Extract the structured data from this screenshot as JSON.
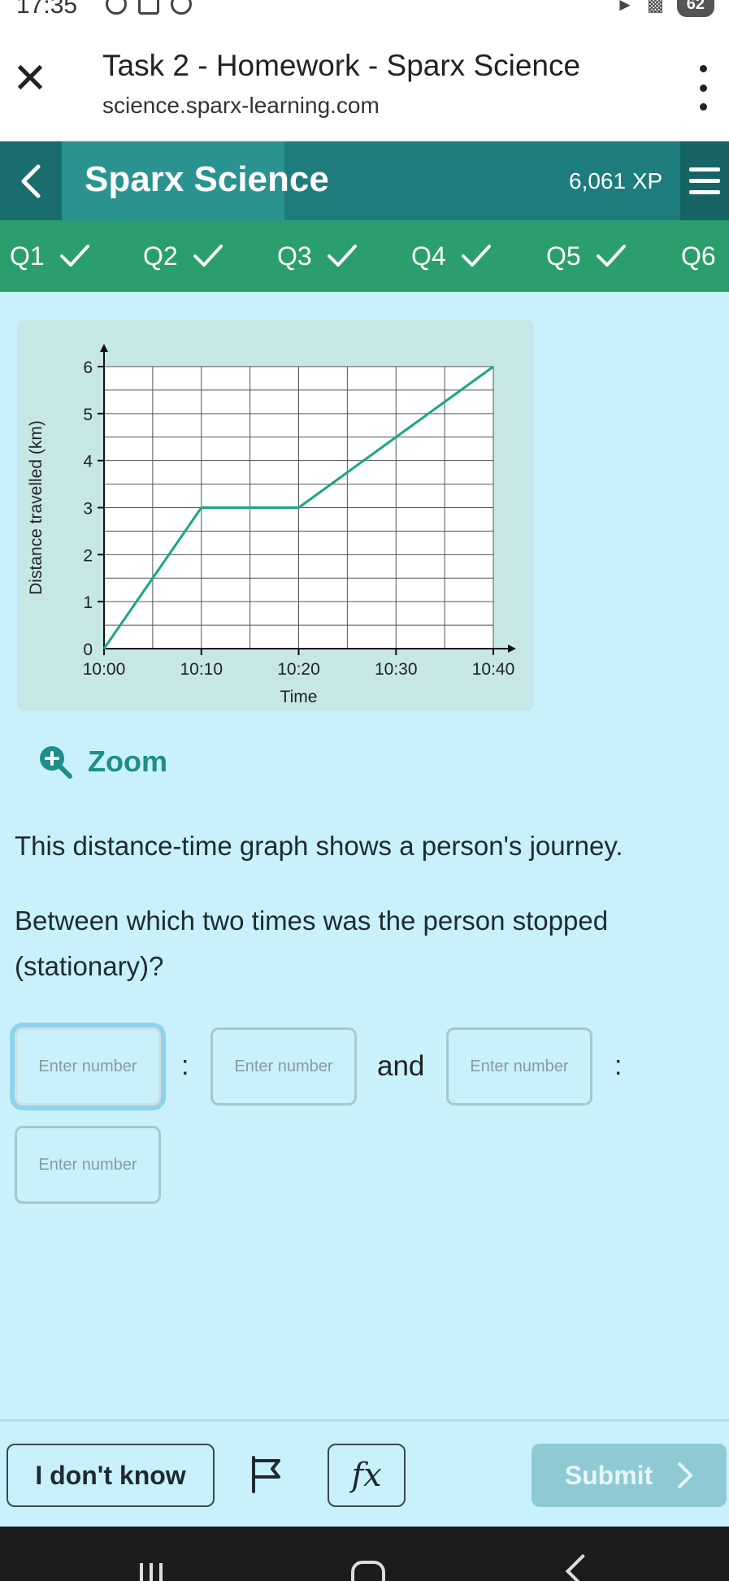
{
  "status_bar": {
    "time": "17:35",
    "battery": "62"
  },
  "browser": {
    "title": "Task 2 - Homework - Sparx Science",
    "url": "science.sparx-learning.com",
    "close_icon": "close-icon",
    "menu_icon": "kebab-menu-icon"
  },
  "app_header": {
    "brand": "Sparx Science",
    "xp": "6,061 XP"
  },
  "question_tabs": [
    {
      "label": "Q1",
      "completed": true
    },
    {
      "label": "Q2",
      "completed": true
    },
    {
      "label": "Q3",
      "completed": true
    },
    {
      "label": "Q4",
      "completed": true
    },
    {
      "label": "Q5",
      "completed": true
    },
    {
      "label": "Q6",
      "completed": false
    }
  ],
  "chart_data": {
    "type": "line",
    "title": "",
    "xlabel": "Time",
    "ylabel": "Distance travelled (km)",
    "x_tick_labels": [
      "10:00",
      "10:10",
      "10:20",
      "10:30",
      "10:40"
    ],
    "x_tick_values": [
      0,
      10,
      20,
      30,
      40
    ],
    "xlim": [
      0,
      40
    ],
    "ylim": [
      0,
      6
    ],
    "y_ticks": [
      0,
      1,
      2,
      3,
      4,
      5,
      6
    ],
    "grid": true,
    "line_color": "#1ba586",
    "series": [
      {
        "x": [
          0,
          10,
          20,
          40
        ],
        "y": [
          0,
          3,
          3,
          6
        ]
      }
    ]
  },
  "zoom": {
    "label": "Zoom",
    "icon": "zoom-in-icon"
  },
  "question": {
    "line1": "This distance-time graph shows a person's journey.",
    "line2": "Between which two times was the person stopped (stationary)?"
  },
  "answers": {
    "placeholder": "Enter number",
    "separator": ":",
    "and_label": "and"
  },
  "bottom_bar": {
    "dont_know": "I don't know",
    "flag_icon": "flag-icon",
    "fx_label": "fx",
    "submit": "Submit"
  },
  "colors": {
    "background": "#c8f1fb",
    "header": "#1e7d7c",
    "tabs": "#2b9e6e",
    "accent": "#1f8d89"
  }
}
